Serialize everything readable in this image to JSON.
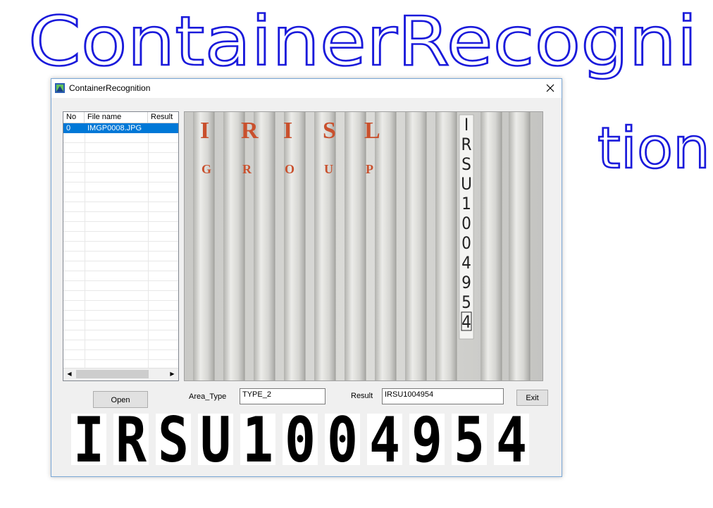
{
  "annotation": {
    "line1": "ContainerRecogni",
    "line2": "tion",
    "color": "#1a1adb"
  },
  "window": {
    "title": "ContainerRecognition",
    "border_color": "#7aa7d6"
  },
  "file_list": {
    "columns": [
      "No",
      "File name",
      "Result"
    ],
    "rows": [
      {
        "no": "0",
        "file_name": "IMGP0008.JPG",
        "result": ""
      }
    ],
    "selected_color": "#0078d7"
  },
  "image": {
    "brand_top": [
      "I",
      "R",
      "I",
      "S",
      "L"
    ],
    "brand_bottom": [
      "G",
      "R",
      "O",
      "U",
      "P"
    ],
    "brand_color": "#c9502d",
    "vertical_code": [
      "I",
      "R",
      "S",
      "U",
      "1",
      "0",
      "0",
      "4",
      "9",
      "5",
      "4"
    ]
  },
  "controls": {
    "open_label": "Open",
    "area_type_label": "Area_Type",
    "area_type_value": "TYPE_2",
    "result_label": "Result",
    "result_value": "IRSU1004954",
    "exit_label": "Exit"
  },
  "segmented_chars": [
    "I",
    "R",
    "S",
    "U",
    "1",
    "0",
    "0",
    "4",
    "9",
    "5",
    "4"
  ]
}
